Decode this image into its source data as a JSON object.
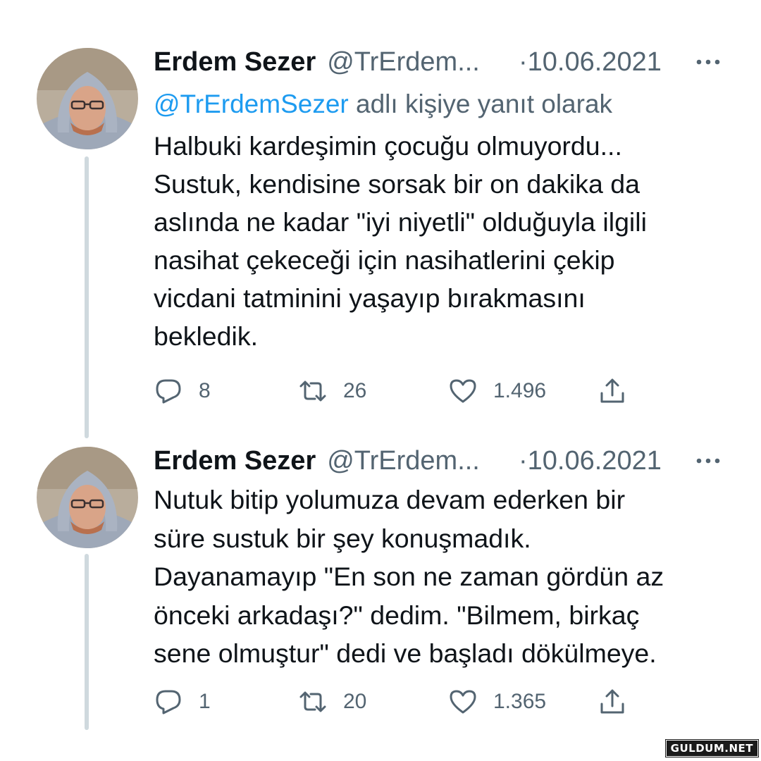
{
  "tweets": [
    {
      "name": "Erdem Sezer",
      "handle": "@TrErdem...",
      "date": "·10.06.2021",
      "reply_mention": "@TrErdemSezer",
      "reply_suffix": " adlı kişiye yanıt olarak",
      "text": "Halbuki kardeşimin çocuğu olmuyordu...\nSustuk, kendisine sorsak bir on dakika da\naslında ne kadar \"iyi niyetli\" olduğuyla ilgili\nnasihat çekeceği için nasihatlerini çekip\nvicdani tatminini yaşayıp bırakmasını\nbekledik.",
      "replies": "8",
      "retweets": "26",
      "likes": "1.496"
    },
    {
      "name": "Erdem Sezer",
      "handle": "@TrErdem...",
      "date": "·10.06.2021",
      "text": "Nutuk bitip yolumuza devam ederken bir\nsüre sustuk bir şey konuşmadık.\nDayanamayıp \"En son ne zaman gördün az\nönceki arkadaşı?\" dedim. \"Bilmem, birkaç\nsene olmuştur\" dedi ve başladı dökülmeye.",
      "replies": "1",
      "retweets": "20",
      "likes": "1.365"
    }
  ],
  "icons": {
    "reply": "reply-icon",
    "retweet": "retweet-icon",
    "like": "heart-icon",
    "share": "share-icon",
    "more": "more-icon"
  },
  "colors": {
    "text": "#0f1419",
    "secondary": "#536471",
    "link": "#1d9bf0",
    "thread_line": "#cfd9de"
  },
  "watermark": "GULDUM.NET"
}
